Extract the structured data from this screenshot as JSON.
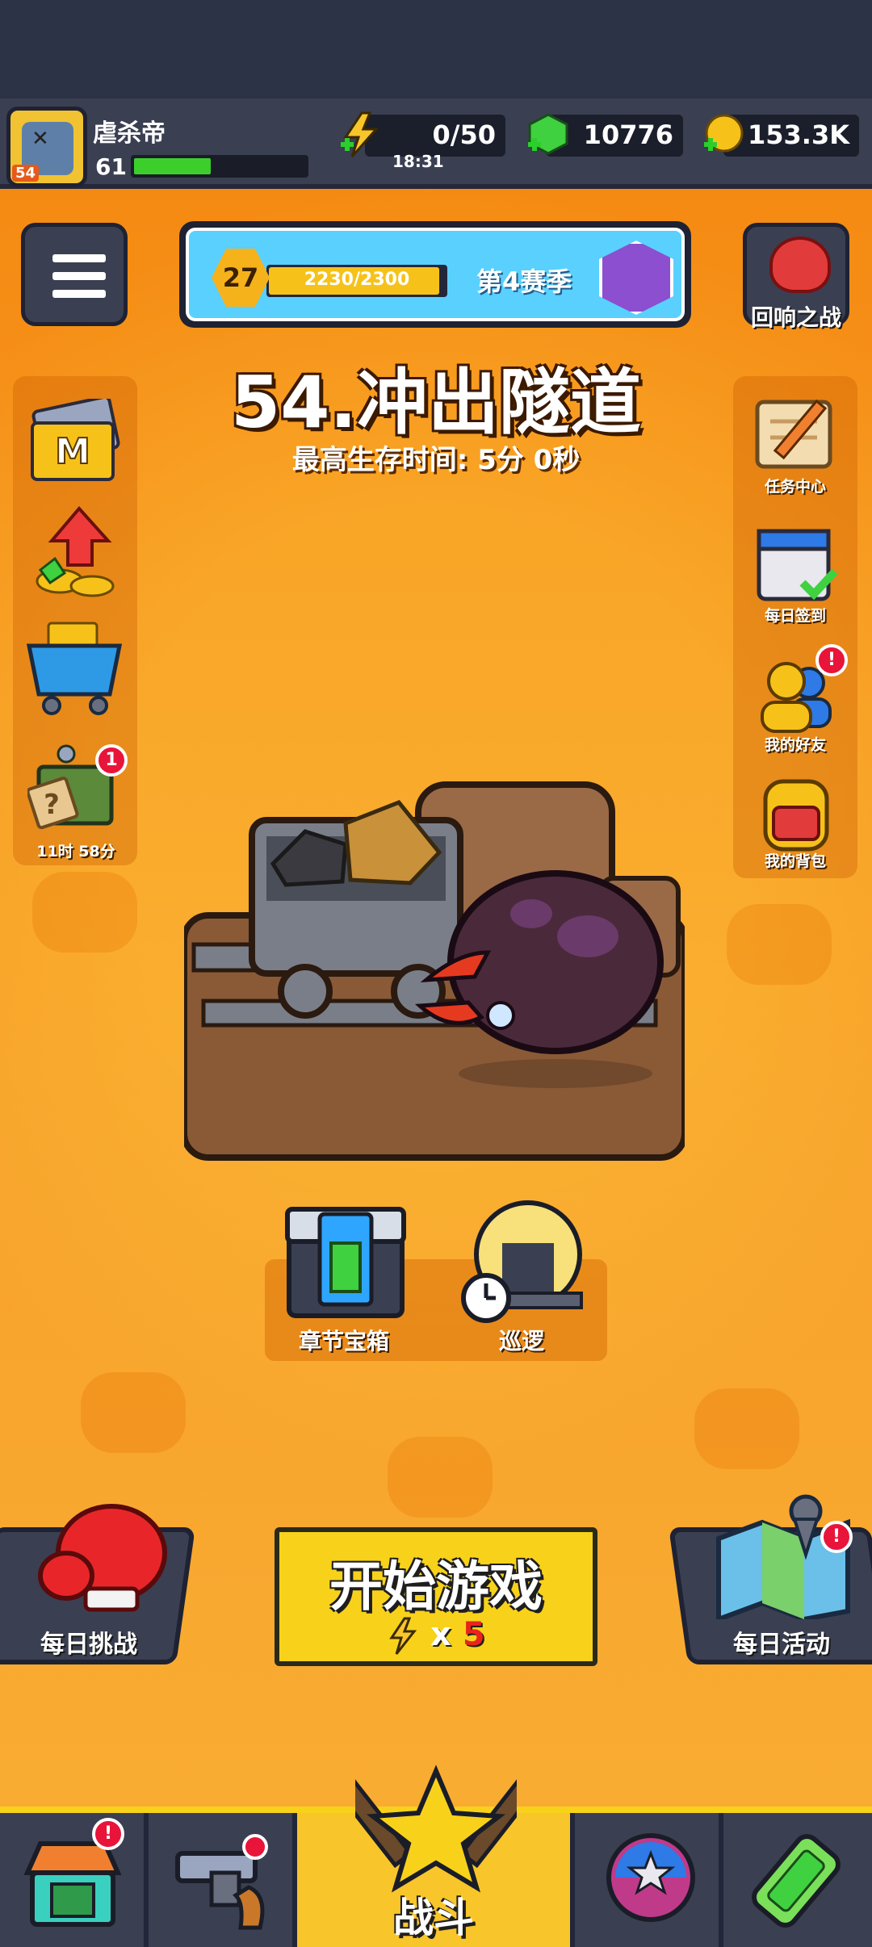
{
  "player": {
    "name": "虐杀帝",
    "level": "61",
    "avatar_level": "54",
    "xp_fraction": 0.45
  },
  "resources": {
    "energy": "0/50",
    "energy_timer": "18:31",
    "gems": "10776",
    "coins": "153.3K"
  },
  "season": {
    "level": "27",
    "progress_text": "2230/2300",
    "progress_fraction": 0.97,
    "label": "第4赛季"
  },
  "top_right": {
    "echo_battle": "回响之战"
  },
  "stage": {
    "title": "54.冲出隧道",
    "best_time": "最高生存时间: 5分 0秒"
  },
  "left_menu": {
    "timer": "11时 58分",
    "badge": "1"
  },
  "right_menu": {
    "items": [
      "任务中心",
      "每日签到",
      "我的好友",
      "我的背包"
    ],
    "badge": "!"
  },
  "chapter": {
    "chest": "章节宝箱",
    "patrol": "巡逻"
  },
  "bottom": {
    "daily_challenge": "每日挑战",
    "daily_event": "每日活动",
    "start_label": "开始游戏",
    "cost_x": "x",
    "cost_n": "5",
    "alert": "!"
  },
  "nav": {
    "battle": "战斗",
    "shop_badge": "!"
  },
  "colors": {
    "background": "#f7931e",
    "panel": "#3a3f52",
    "accent_yellow": "#f8d21a",
    "xp_green": "#3ccf2c",
    "badge_red": "#e8143a"
  }
}
